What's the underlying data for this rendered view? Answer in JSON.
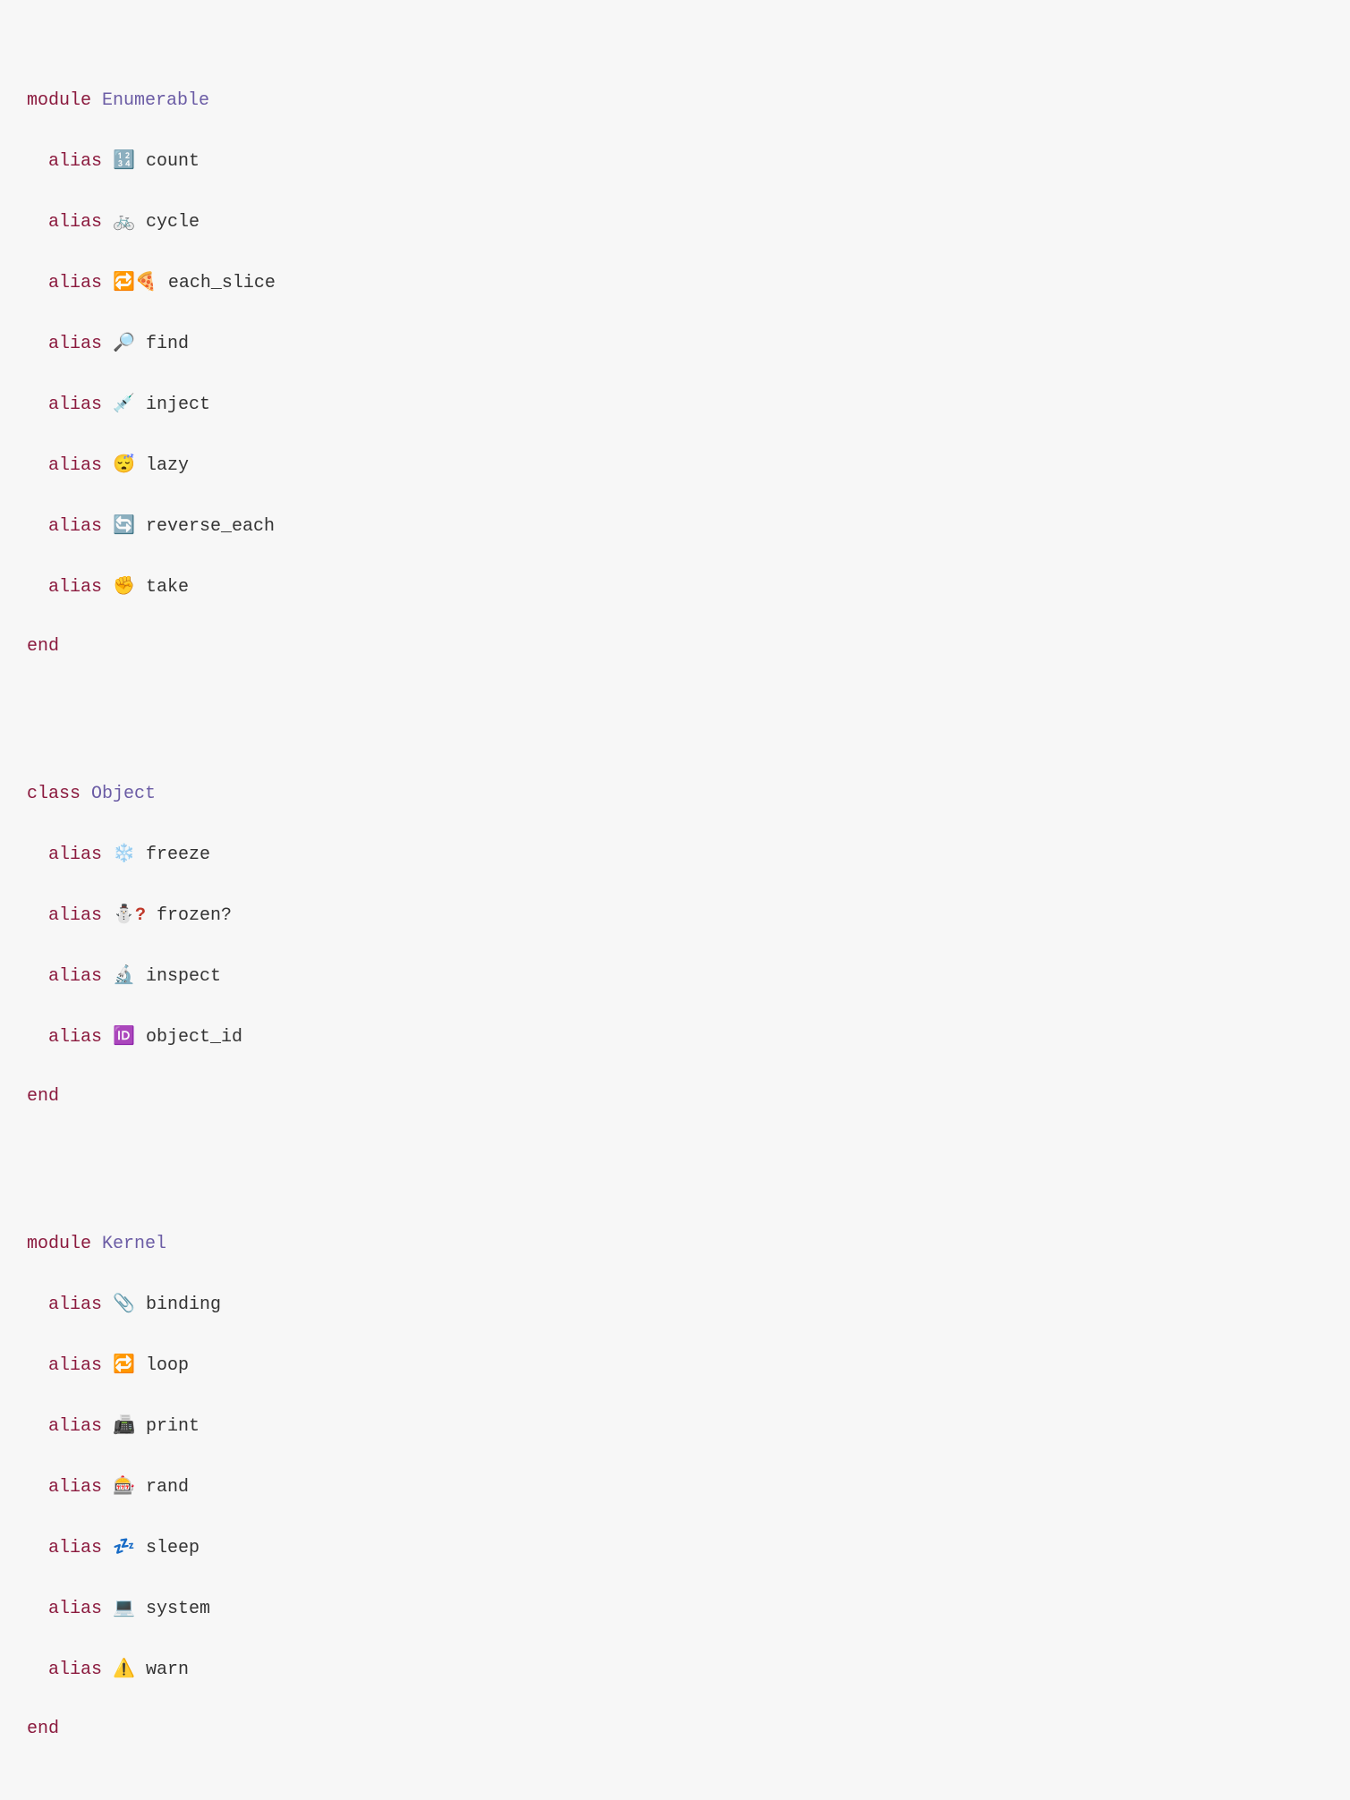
{
  "keywords": {
    "module": "module",
    "class": "class",
    "end": "end",
    "alias": "alias"
  },
  "blocks": [
    {
      "type": "module",
      "name": "Enumerable",
      "aliases": [
        {
          "emoji": "🔢",
          "method": "count"
        },
        {
          "emoji": "🚲",
          "method": "cycle"
        },
        {
          "emoji": "🔁🍕",
          "method": "each_slice"
        },
        {
          "emoji": "🔎",
          "method": "find"
        },
        {
          "emoji": "💉",
          "method": "inject"
        },
        {
          "emoji": "😴",
          "method": "lazy"
        },
        {
          "emoji": "🔄",
          "method": "reverse_each"
        },
        {
          "emoji": "✊",
          "method": "take"
        }
      ]
    },
    {
      "type": "class",
      "name": "Object",
      "aliases": [
        {
          "emoji": "❄️",
          "method": "freeze"
        },
        {
          "emoji": "⛄",
          "qmark": "?",
          "method": "frozen?"
        },
        {
          "emoji": "🔬",
          "method": "inspect"
        },
        {
          "emoji": "🆔",
          "method": "object_id"
        }
      ]
    },
    {
      "type": "module",
      "name": "Kernel",
      "aliases": [
        {
          "emoji": "📎",
          "method": "binding"
        },
        {
          "emoji": "🔁",
          "method": "loop"
        },
        {
          "emoji": "📠",
          "method": "print"
        },
        {
          "emoji": "🎰",
          "method": "rand"
        },
        {
          "emoji": "💤",
          "method": "sleep"
        },
        {
          "emoji": "💻",
          "method": "system"
        },
        {
          "emoji": "⚠️",
          "method": "warn"
        }
      ]
    }
  ]
}
